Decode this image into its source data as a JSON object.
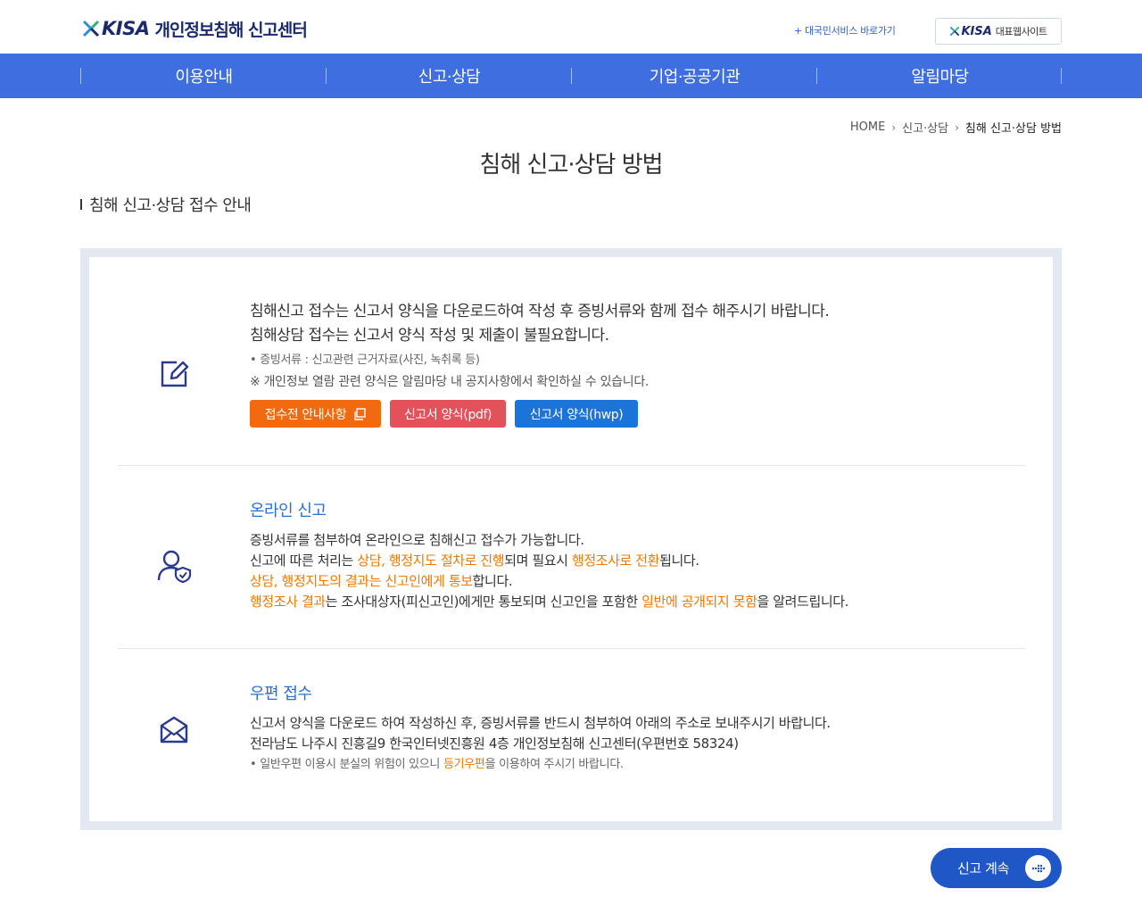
{
  "header": {
    "logo_brand": "KISA",
    "logo_title": "개인정보침해 신고센터",
    "top_link": "+ 대국민서비스 바로가기",
    "site_button_brand": "KISA",
    "site_button_label": "대표웹사이트"
  },
  "nav": {
    "items": [
      {
        "label": "이용안내"
      },
      {
        "label": "신고·상담"
      },
      {
        "label": "기업·공공기관"
      },
      {
        "label": "알림마당"
      }
    ]
  },
  "breadcrumb": {
    "home": "HOME",
    "level1": "신고·상담",
    "current": "침해 신고·상담 방법"
  },
  "page_title": "침해 신고·상담 방법",
  "section_title": "침해 신고·상담 접수 안내",
  "block1": {
    "icon": "edit-icon",
    "line1": "침해신고 접수는 신고서 양식을 다운로드하여 작성 후 증빙서류와 함께 접수 해주시기 바랍니다.",
    "line2": "침해상담 접수는 신고서 양식 작성 및 제출이 불필요합니다.",
    "note1": "• 증빙서류 : 신고관련 근거자료(사진, 녹취록 등)",
    "note2": "※ 개인정보 열람 관련 양식은 알림마당 내 공지사항에서 확인하실 수 있습니다.",
    "btn_notice": "접수전 안내사항",
    "btn_pdf": "신고서 양식(pdf)",
    "btn_hwp": "신고서 양식(hwp)"
  },
  "block2": {
    "icon": "user-shield-icon",
    "title": "온라인 신고",
    "line1": "증빙서류를 첨부하여 온라인으로 침해신고 접수가 가능합니다.",
    "line2_a": "신고에 따른 처리는 ",
    "line2_b": "상담, 행정지도 절차로 진행",
    "line2_c": "되며 필요시 ",
    "line2_d": "행정조사로 전환",
    "line2_e": "됩니다.",
    "line3_a": "상담, 행정지도의 결과는 신고인에게 통보",
    "line3_b": "합니다.",
    "line4_a": "행정조사 결과",
    "line4_b": "는 조사대상자(피신고인)에게만 통보되며 신고인을 포함한 ",
    "line4_c": "일반에 공개되지 못함",
    "line4_d": "을 알려드립니다."
  },
  "block3": {
    "icon": "mail-icon",
    "title": "우편 접수",
    "line1": "신고서 양식을 다운로드 하여 작성하신 후, 증빙서류를 반드시 첨부하여 아래의 주소로 보내주시기 바랍니다.",
    "line2": "전라남도 나주시 진흥길9 한국인터넷진흥원 4층 개인정보침해 신고센터(우편번호 58324)",
    "note_a": "• 일반우편 이용시 분실의 위험이 있으니 ",
    "note_b": "등기우편",
    "note_c": "을 이용하여 주시기 바랍니다."
  },
  "continue_button": "신고 계속",
  "colors": {
    "nav_bg": "#3f6ee0",
    "accent_orange": "#f07800",
    "link_blue": "#2c6fcf",
    "btn_orange": "#f26a0f",
    "btn_red": "#e3525a",
    "btn_blue": "#1c73d8",
    "continue_bg": "#2057c6"
  }
}
